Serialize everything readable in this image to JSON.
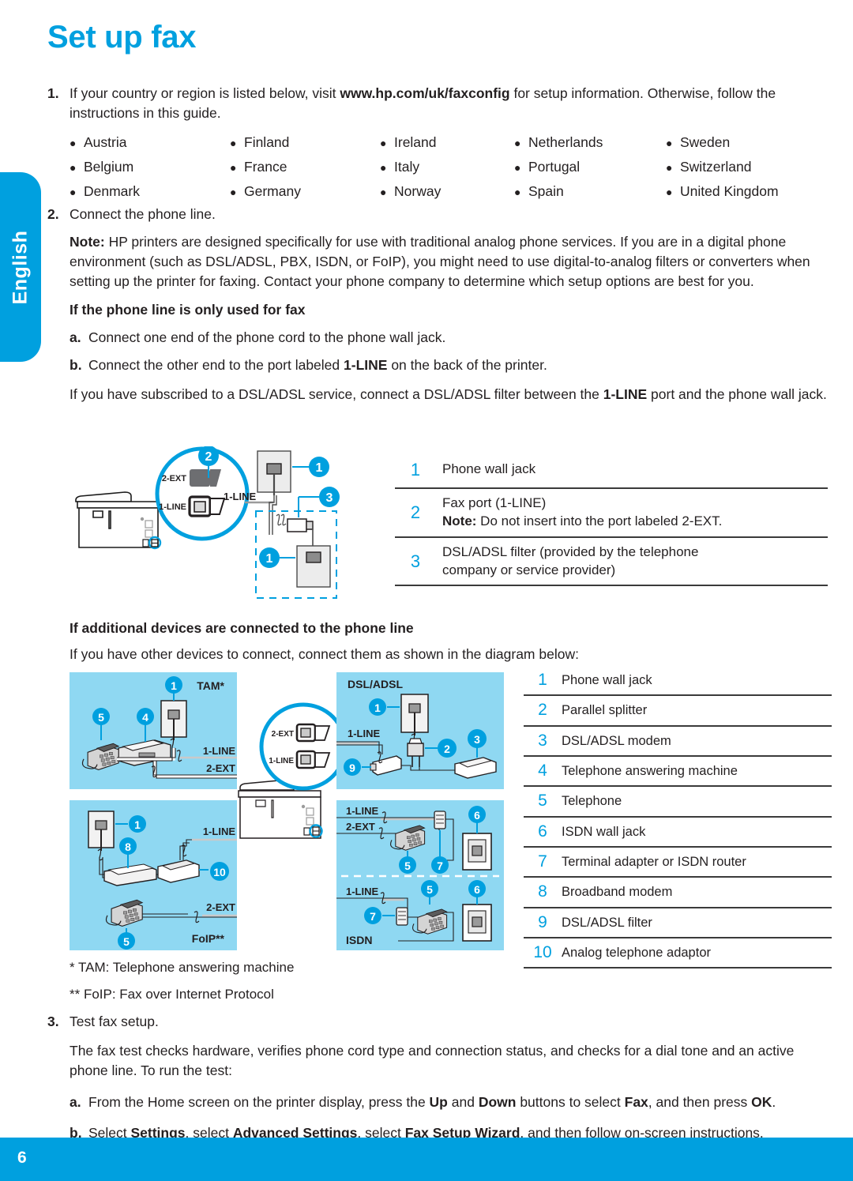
{
  "page": {
    "title": "Set up fax",
    "language_tab": "English",
    "page_number": "6",
    "accent_color": "#00a0df",
    "panel_fill": "#8fd8f2"
  },
  "steps": {
    "s1": {
      "num": "1.",
      "text_before": "If your country or region is listed below, visit ",
      "url": "www.hp.com/uk/faxconfig",
      "text_after": " for setup information. Otherwise, follow the instructions in this guide."
    },
    "s2": {
      "num": "2.",
      "text": "Connect the phone line."
    },
    "s3": {
      "num": "3.",
      "text": "Test fax setup."
    }
  },
  "countries": [
    "Austria",
    "Finland",
    "Ireland",
    "Netherlands",
    "Sweden",
    "Belgium",
    "France",
    "Italy",
    "Portugal",
    "Switzerland",
    "Denmark",
    "Germany",
    "Norway",
    "Spain",
    "United Kingdom"
  ],
  "note": {
    "label": "Note:",
    "text": " HP printers are designed specifically for use with traditional analog phone services. If you are in a digital phone environment (such as DSL/ADSL, PBX, ISDN, or FoIP), you might need to use digital-to-analog filters or converters when setting up the printer for faxing. Contact your phone company to determine which setup options are best for you."
  },
  "fax_only": {
    "heading": "If the phone line is only used for fax",
    "a": {
      "ltr": "a.",
      "text": "Connect one end of the phone cord to the phone wall jack."
    },
    "b": {
      "ltr": "b.",
      "text_1": "Connect the other end to the port labeled ",
      "bold": "1-LINE",
      "text_2": " on the back of the printer."
    },
    "dsl_para_1": "If you have subscribed to a DSL/ADSL service, connect a DSL/ADSL filter between the ",
    "dsl_bold": "1-LINE",
    "dsl_para_2": " port and the phone wall jack."
  },
  "diagram1": {
    "labels": {
      "two_ext": "2-EXT",
      "one_line_port": "1-LINE",
      "one_line_cable": "1-LINE"
    },
    "callouts": [
      "1",
      "2",
      "3"
    ],
    "legend": [
      {
        "idx": "1",
        "text": "Phone wall jack"
      },
      {
        "idx": "2",
        "line1": "Fax port (1-LINE)",
        "note_label": "Note:",
        "note_text": " Do not insert into the port labeled 2-EXT."
      },
      {
        "idx": "3",
        "line1": "DSL/ADSL filter (provided by the telephone",
        "line2": "company or service provider)"
      }
    ]
  },
  "additional_devices": {
    "heading": "If additional devices are connected to the phone line",
    "intro": "If you have other devices to connect, connect them as shown in the diagram below:"
  },
  "diagram2": {
    "panel_titles": {
      "tam": "TAM*",
      "foip": "FoIP**",
      "dsl": "DSL/ADSL",
      "isdn": "ISDN"
    },
    "port_labels": {
      "one_line": "1-LINE",
      "two_ext": "2-EXT"
    },
    "zoom_ports": {
      "two_ext": "2-EXT",
      "one_line": "1-LINE"
    },
    "legend": [
      {
        "idx": "1",
        "text": "Phone wall jack"
      },
      {
        "idx": "2",
        "text": "Parallel splitter"
      },
      {
        "idx": "3",
        "text": "DSL/ADSL modem"
      },
      {
        "idx": "4",
        "text": "Telephone answering machine"
      },
      {
        "idx": "5",
        "text": "Telephone"
      },
      {
        "idx": "6",
        "text": "ISDN wall jack"
      },
      {
        "idx": "7",
        "text": "Terminal adapter or ISDN router"
      },
      {
        "idx": "8",
        "text": "Broadband modem"
      },
      {
        "idx": "9",
        "text": "DSL/ADSL filter"
      },
      {
        "idx": "10",
        "text": "Analog telephone adaptor"
      }
    ]
  },
  "footnotes": {
    "tam": "*  TAM: Telephone answering machine",
    "foip": "** FoIP: Fax over Internet Protocol"
  },
  "test_fax": {
    "intro": "The fax test checks hardware, verifies phone cord type and connection status, and checks for a dial tone and an active phone line. To run the test:",
    "a": {
      "ltr": "a.",
      "t1": "From the Home screen on the printer display, press the ",
      "b1": "Up",
      "t2": " and ",
      "b2": "Down",
      "t3": " buttons to select ",
      "b3": "Fax",
      "t4": ", and then press ",
      "b4": "OK",
      "t5": "."
    },
    "b": {
      "ltr": "b.",
      "t1": "Select ",
      "b1": "Settings",
      "t2": ", select ",
      "b2": "Advanced Settings",
      "t3": ", select ",
      "b3": "Fax Setup Wizard",
      "t4": ", and then follow on-screen instructions."
    }
  }
}
